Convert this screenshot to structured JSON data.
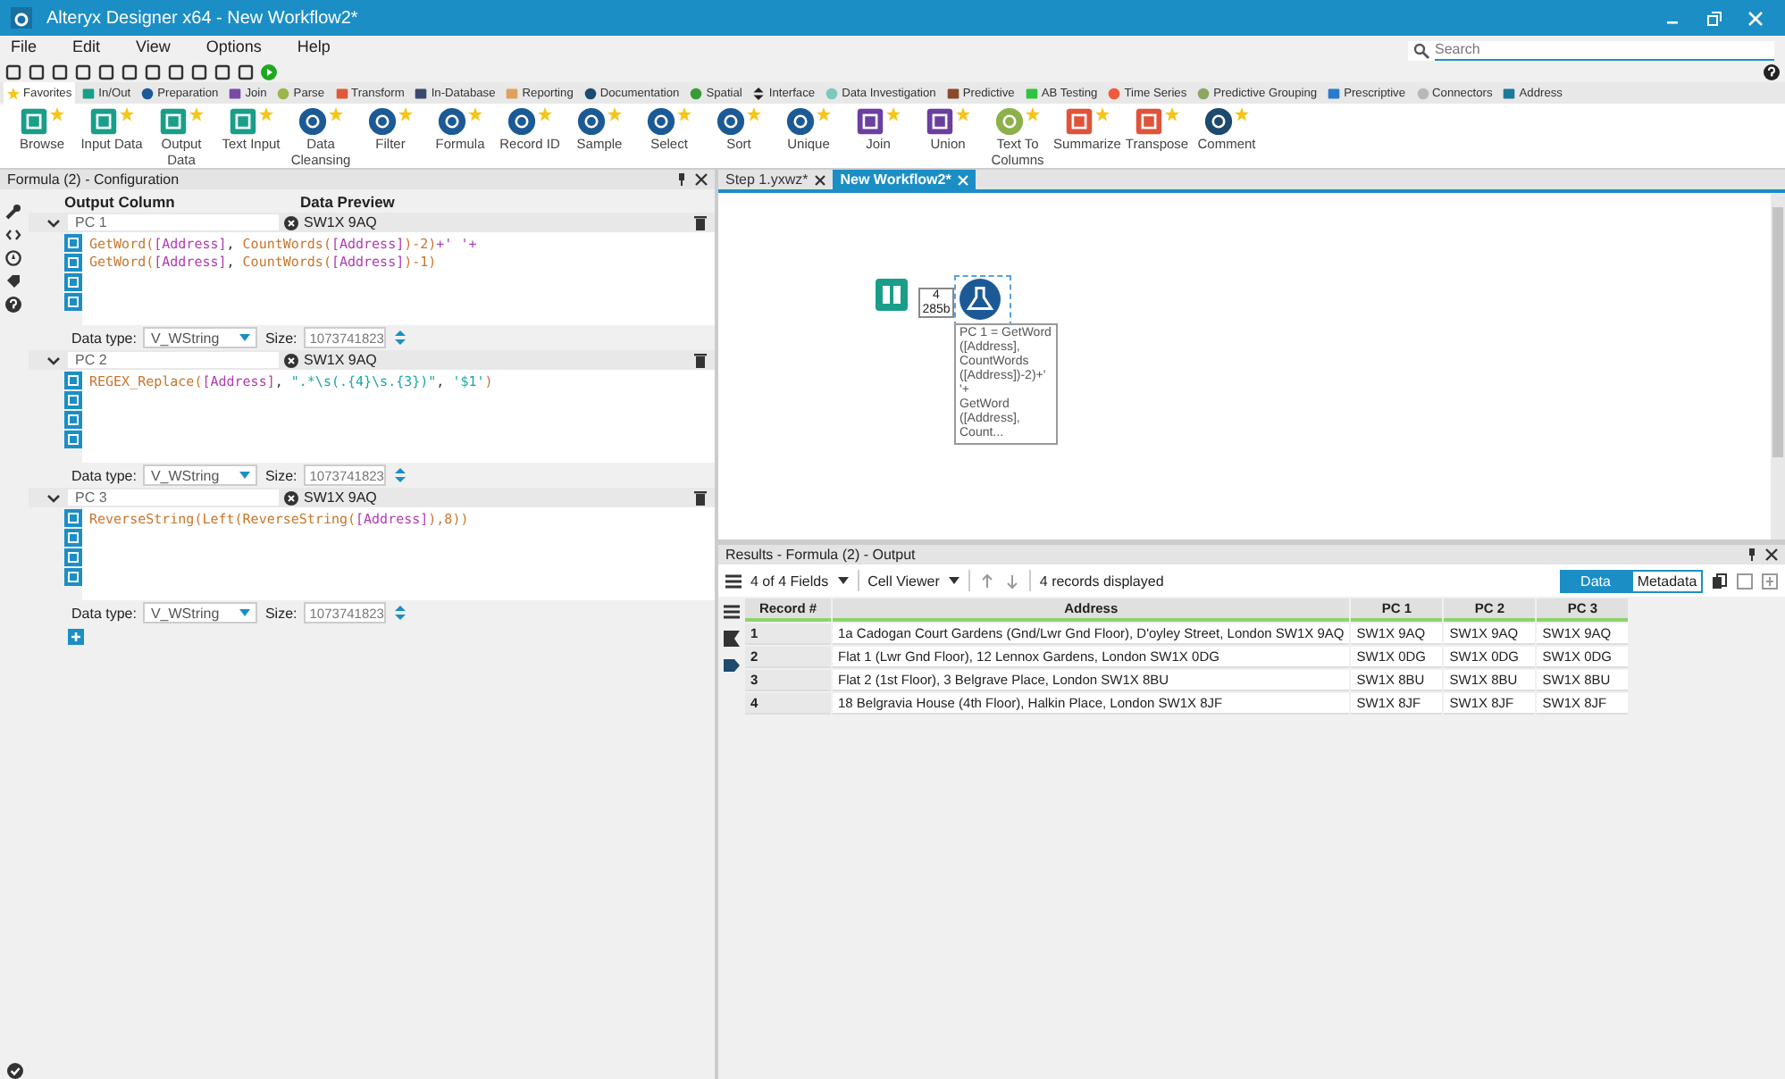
{
  "window": {
    "title": "Alteryx Designer x64 - New Workflow2*"
  },
  "menu": [
    "File",
    "Edit",
    "View",
    "Options",
    "Help"
  ],
  "search": {
    "placeholder": "Search"
  },
  "tool_categories": [
    {
      "label": "Favorites",
      "kind": "star",
      "color": "#f5c518",
      "selected": true
    },
    {
      "label": "In/Out",
      "kind": "square",
      "color": "#1a9e8a",
      "selected": false
    },
    {
      "label": "Preparation",
      "kind": "circle",
      "color": "#1c5a96",
      "selected": false
    },
    {
      "label": "Join",
      "kind": "square",
      "color": "#7b4aa8",
      "selected": false
    },
    {
      "label": "Parse",
      "kind": "circle",
      "color": "#9cb54c",
      "selected": false
    },
    {
      "label": "Transform",
      "kind": "square",
      "color": "#e05a3a",
      "selected": false
    },
    {
      "label": "In-Database",
      "kind": "square",
      "color": "#3b4a6b",
      "selected": false
    },
    {
      "label": "Reporting",
      "kind": "square",
      "color": "#e0a060",
      "selected": false
    },
    {
      "label": "Documentation",
      "kind": "circle",
      "color": "#1e4a6e",
      "selected": false
    },
    {
      "label": "Spatial",
      "kind": "circle",
      "color": "#3a9a3a",
      "selected": false
    },
    {
      "label": "Interface",
      "kind": "arrows",
      "color": "#222222",
      "selected": false
    },
    {
      "label": "Data Investigation",
      "kind": "circle",
      "color": "#7cc8c0",
      "selected": false
    },
    {
      "label": "Predictive",
      "kind": "square",
      "color": "#8a4a2a",
      "selected": false
    },
    {
      "label": "AB Testing",
      "kind": "square",
      "color": "#2ec440",
      "selected": false
    },
    {
      "label": "Time Series",
      "kind": "circle",
      "color": "#f05a3a",
      "selected": false
    },
    {
      "label": "Predictive Grouping",
      "kind": "circle",
      "color": "#8aa860",
      "selected": false
    },
    {
      "label": "Prescriptive",
      "kind": "square",
      "color": "#2a7ad0",
      "selected": false
    },
    {
      "label": "Connectors",
      "kind": "circle",
      "color": "#b8b8b8",
      "selected": false
    },
    {
      "label": "Address",
      "kind": "square",
      "color": "#1a7a9a",
      "selected": false
    }
  ],
  "tools": [
    {
      "label": "Browse",
      "kind": "square",
      "color": "#1a9e8a"
    },
    {
      "label": "Input Data",
      "kind": "square",
      "color": "#1a9e8a"
    },
    {
      "label": "Output Data",
      "kind": "square",
      "color": "#1a9e8a"
    },
    {
      "label": "Text Input",
      "kind": "square",
      "color": "#1a9e8a"
    },
    {
      "label": "Data Cleansing",
      "kind": "circle",
      "color": "#1c5a96"
    },
    {
      "label": "Filter",
      "kind": "circle",
      "color": "#1c5a96"
    },
    {
      "label": "Formula",
      "kind": "circle",
      "color": "#1c5a96"
    },
    {
      "label": "Record ID",
      "kind": "circle",
      "color": "#1c5a96"
    },
    {
      "label": "Sample",
      "kind": "circle",
      "color": "#1c5a96"
    },
    {
      "label": "Select",
      "kind": "circle",
      "color": "#1c5a96"
    },
    {
      "label": "Sort",
      "kind": "circle",
      "color": "#1c5a96"
    },
    {
      "label": "Unique",
      "kind": "circle",
      "color": "#1c5a96"
    },
    {
      "label": "Join",
      "kind": "square",
      "color": "#6b3fa0"
    },
    {
      "label": "Union",
      "kind": "square",
      "color": "#6b3fa0"
    },
    {
      "label": "Text To Columns",
      "kind": "circle",
      "color": "#8db04b"
    },
    {
      "label": "Summarize",
      "kind": "square",
      "color": "#e0533a"
    },
    {
      "label": "Transpose",
      "kind": "square",
      "color": "#e0533a"
    },
    {
      "label": "Comment",
      "kind": "circle",
      "color": "#1e4a6e"
    }
  ],
  "config": {
    "title": "Formula (2) - Configuration",
    "columns": [
      "Output Column",
      "Data Preview"
    ],
    "formulas": [
      {
        "name": "PC 1",
        "preview": "SW1X 9AQ",
        "lines": [
          [
            {
              "kind": "fn",
              "text": "GetWord("
            },
            {
              "kind": "field",
              "text": "[Address]"
            },
            {
              "kind": "op",
              "text": ", "
            },
            {
              "kind": "fn",
              "text": "CountWords("
            },
            {
              "kind": "field",
              "text": "[Address]"
            },
            {
              "kind": "fn",
              "text": ")-2)"
            },
            {
              "kind": "field",
              "text": "+' '+"
            }
          ],
          [
            {
              "kind": "fn",
              "text": "GetWord("
            },
            {
              "kind": "field",
              "text": "[Address]"
            },
            {
              "kind": "op",
              "text": ", "
            },
            {
              "kind": "fn",
              "text": "CountWords("
            },
            {
              "kind": "field",
              "text": "[Address]"
            },
            {
              "kind": "fn",
              "text": ")-1)"
            }
          ]
        ],
        "data_type_label": "Data type:",
        "data_type": "V_WString",
        "size_label": "Size:",
        "size": "1073741823"
      },
      {
        "name": "PC 2",
        "preview": "SW1X 9AQ",
        "lines": [
          [
            {
              "kind": "fn",
              "text": "REGEX_Replace("
            },
            {
              "kind": "field",
              "text": "[Address]"
            },
            {
              "kind": "op",
              "text": ", "
            },
            {
              "kind": "str",
              "text": "\".*\\s(.{4}\\s.{3})\""
            },
            {
              "kind": "op",
              "text": ", "
            },
            {
              "kind": "str",
              "text": "'$1'"
            },
            {
              "kind": "fn",
              "text": ")"
            }
          ]
        ],
        "data_type_label": "Data type:",
        "data_type": "V_WString",
        "size_label": "Size:",
        "size": "1073741823"
      },
      {
        "name": "PC 3",
        "preview": "SW1X 9AQ",
        "lines": [
          [
            {
              "kind": "fn",
              "text": "ReverseString(Left(ReverseString("
            },
            {
              "kind": "field",
              "text": "[Address]"
            },
            {
              "kind": "fn",
              "text": "),8))"
            }
          ]
        ],
        "data_type_label": "Data type:",
        "data_type": "V_WString",
        "size_label": "Size:",
        "size": "1073741823"
      }
    ]
  },
  "workflow_tabs": [
    {
      "label": "Step 1.yxwz*",
      "selected": false
    },
    {
      "label": "New Workflow2*",
      "selected": true
    }
  ],
  "canvas": {
    "connection": [
      "4",
      "285b"
    ],
    "annotation": [
      "PC 1 = GetWord",
      "([Address],",
      "CountWords",
      "([Address])-2)+'",
      "'+",
      "GetWord",
      "([Address],",
      "Count..."
    ]
  },
  "results": {
    "title": "Results - Formula (2) - Output",
    "fields": "4 of 4 Fields",
    "viewer": "Cell Viewer",
    "count": "4 records displayed",
    "views": [
      {
        "label": "Data",
        "selected": true
      },
      {
        "label": "Metadata",
        "selected": false
      }
    ],
    "columns": [
      "Record #",
      "Address",
      "PC 1",
      "PC 2",
      "PC 3"
    ],
    "rows": [
      [
        "1",
        "1a Cadogan Court Gardens (Gnd/Lwr Gnd Floor), D'oyley Street, London SW1X 9AQ",
        "SW1X 9AQ",
        "SW1X 9AQ",
        "SW1X 9AQ"
      ],
      [
        "2",
        "Flat 1 (Lwr Gnd Floor), 12 Lennox Gardens, London SW1X 0DG",
        "SW1X 0DG",
        "SW1X 0DG",
        "SW1X 0DG"
      ],
      [
        "3",
        "Flat 2 (1st Floor), 3 Belgrave Place, London SW1X 8BU",
        "SW1X 8BU",
        "SW1X 8BU",
        "SW1X 8BU"
      ],
      [
        "4",
        "18 Belgravia House (4th Floor), Halkin Place, London SW1X 8JF",
        "SW1X 8JF",
        "SW1X 8JF",
        "SW1X 8JF"
      ]
    ]
  }
}
